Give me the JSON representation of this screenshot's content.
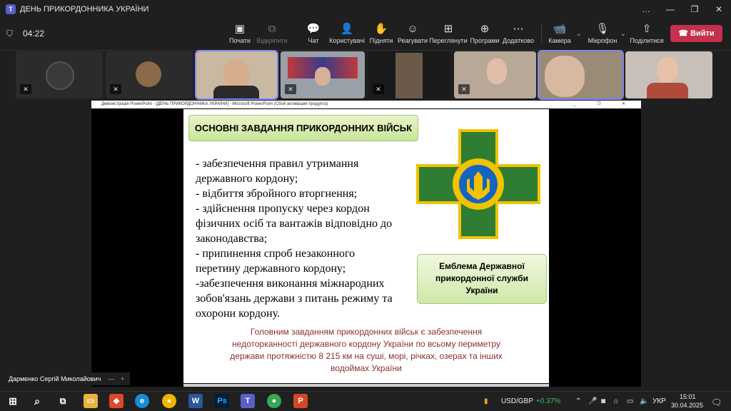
{
  "window": {
    "title": "ДЕНЬ ПРИКОРДОННИКА УКРАЇНИ",
    "controls": [
      "…",
      "—",
      "❐",
      "✕"
    ]
  },
  "meeting": {
    "timer": "04:22",
    "toolbar": [
      {
        "label": "Почати",
        "icon": "▣"
      },
      {
        "label": "Відкріпити",
        "icon": "⧉"
      },
      {
        "label": "Чат",
        "icon": "💬"
      },
      {
        "label": "Користувачі",
        "icon": "👤"
      },
      {
        "label": "Підняти",
        "icon": "✋"
      },
      {
        "label": "Реагувати",
        "icon": "☺"
      },
      {
        "label": "Переглянути",
        "icon": "⊞"
      },
      {
        "label": "Програми",
        "icon": "⊕"
      },
      {
        "label": "Додатково",
        "icon": "⋯"
      },
      {
        "label": "Камера",
        "icon": "📹"
      },
      {
        "label": "Мікрофон",
        "icon": "🎙"
      },
      {
        "label": "Поділитися",
        "icon": "⇧"
      }
    ],
    "leave_label": "Вийти",
    "presenter": "Дарменко Сергій Миколайович"
  },
  "powerpoint": {
    "bar_title": "Демонстрація PowerPoint - [ДЕНЬ ПРИКОРДОННИКА УКРАЇНИ] - Microsoft PowerPoint (Сбой активации продукта)",
    "bar_buttons": "_ ❐ ✕"
  },
  "slide": {
    "title": "ОСНОВНІ ЗАВДАННЯ ПРИКОРДОННИХ ВІЙСЬК",
    "tasks": [
      "- забезпечення правил утримання",
      "державного кордону;",
      "- відбиття збройного вторгнення;",
      "- здійснення пропуску через кордон",
      "фізичних осіб та вантажів відповідно до",
      "законодавства;",
      "- припинення спроб незаконного",
      "перетину державного кордону;",
      "-забезпечення виконання міжнародних",
      "зобов'язань держави з питань режиму та",
      "охорони кордону."
    ],
    "emblem_caption": [
      "Емблема Державної",
      "прикордонної служби",
      "України"
    ],
    "summary": [
      "Головним завданням прикордонних військ є  забезпечення",
      "недоторканності державного кордону України по всьому периметру",
      "держави протяжністю 8 215 км на суші, морі, річках, озерах та інших",
      "водоймах України"
    ],
    "colors": {
      "title_fill": "#c9e59a",
      "emblem_green": "#2e7d32",
      "emblem_gold": "#f2c200",
      "summary_text": "#8b2e2e"
    }
  },
  "taskbar": {
    "ticker_pair": "USD/GBP",
    "ticker_change": "+0.37%",
    "language": "УКР",
    "time": "15:01",
    "date": "30.04.2025"
  }
}
